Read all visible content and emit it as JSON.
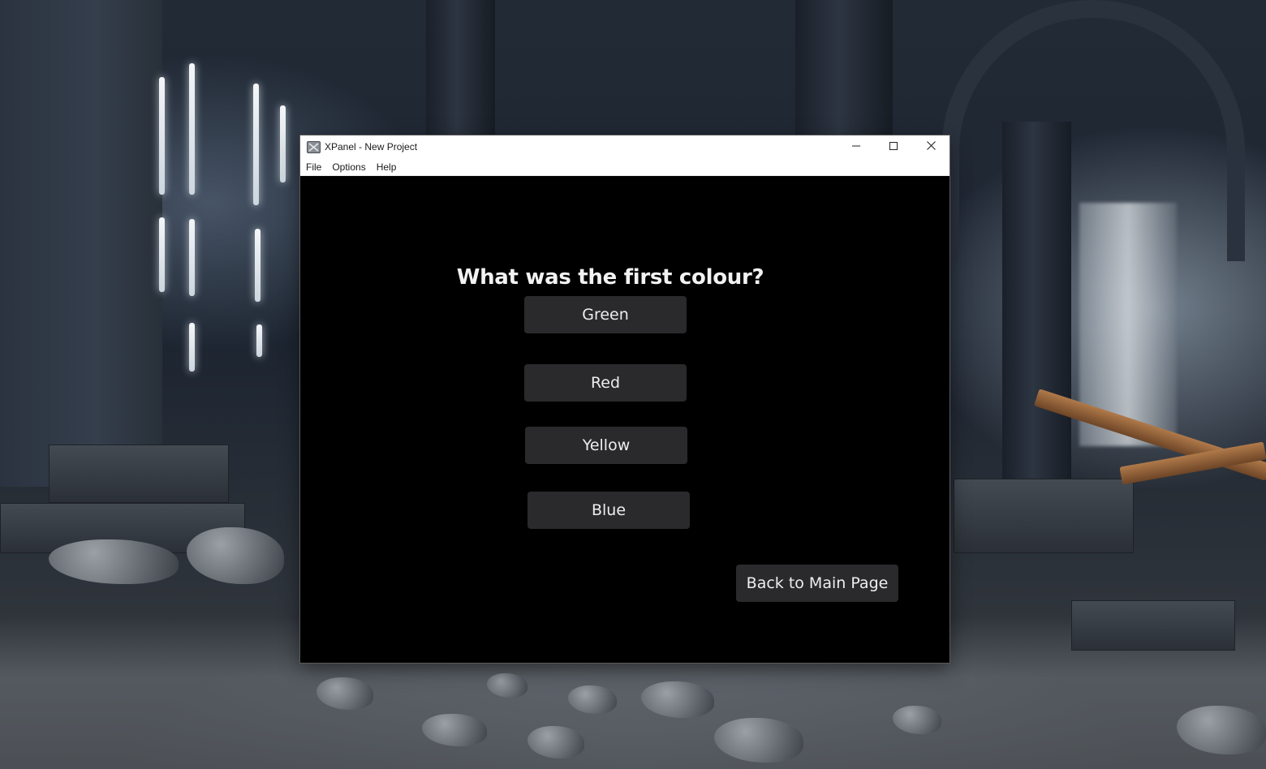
{
  "window": {
    "title": "XPanel - New Project",
    "controls": {
      "minimize_icon": "minimize-icon",
      "maximize_icon": "maximize-icon",
      "close_icon": "close-icon"
    }
  },
  "menu": {
    "items": [
      "File",
      "Options",
      "Help"
    ]
  },
  "quiz": {
    "question": "What was the first colour?",
    "answers": [
      "Green",
      "Red",
      "Yellow",
      "Blue"
    ],
    "back_label": "Back to Main Page"
  },
  "colors": {
    "window_background": "#000000",
    "button_background": "#2a2a2c",
    "text": "#eeeeee",
    "titlebar": "#ffffff"
  }
}
